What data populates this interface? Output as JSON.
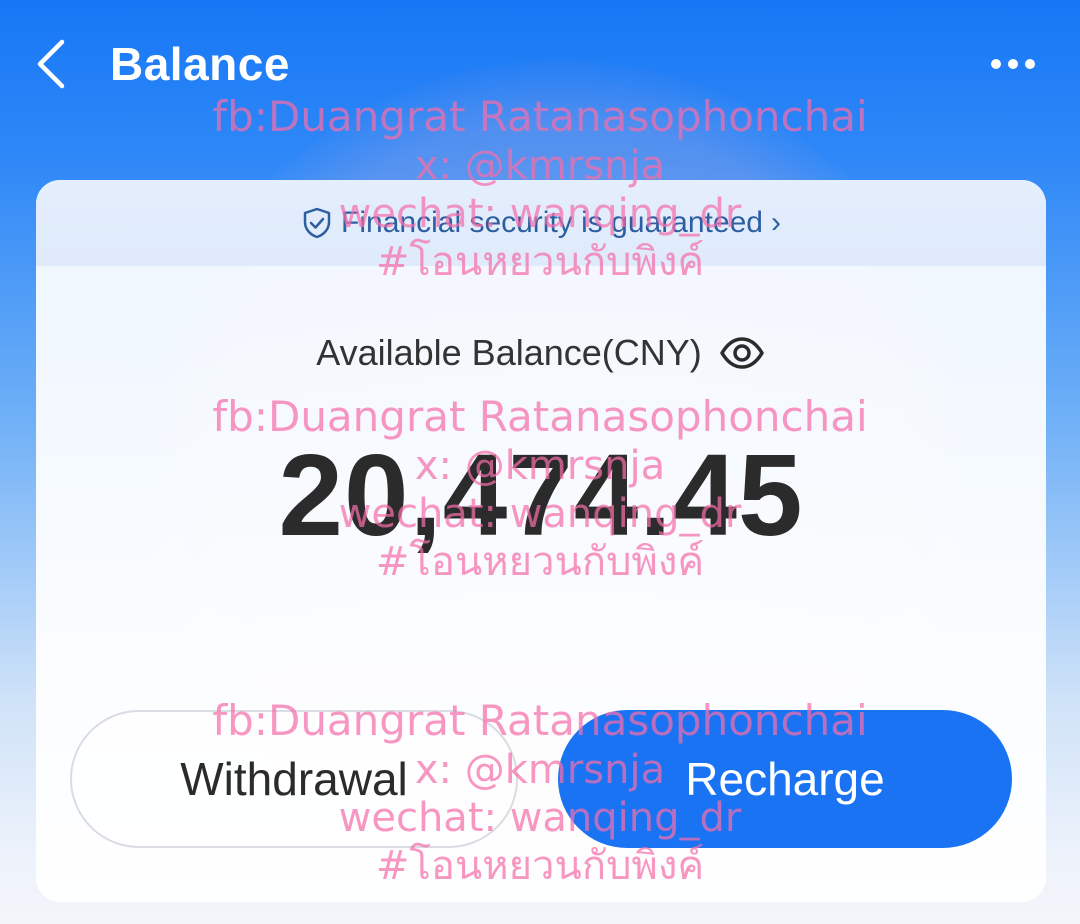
{
  "header": {
    "title": "Balance",
    "back_icon": "chevron-left-icon",
    "more_icon": "more-horizontal-icon"
  },
  "security": {
    "text": "Financial security is guaranteed",
    "icon": "shield-check-icon",
    "chevron": "›"
  },
  "balance": {
    "label": "Available Balance(CNY)",
    "amount": "20,474.45",
    "eye_icon": "eye-icon"
  },
  "actions": {
    "withdraw_label": "Withdrawal",
    "recharge_label": "Recharge"
  },
  "watermark": {
    "fb": "fb:Duangrat Ratanasophonchai",
    "x": "x: @kmrsnja",
    "wechat": "wechat: wanqing_dr",
    "hashtag": "#โอนหยวนกับพิงค์"
  },
  "colors": {
    "primary": "#1a73f2",
    "watermark": "#f56eaa",
    "text_dark": "#2b2b2b"
  }
}
